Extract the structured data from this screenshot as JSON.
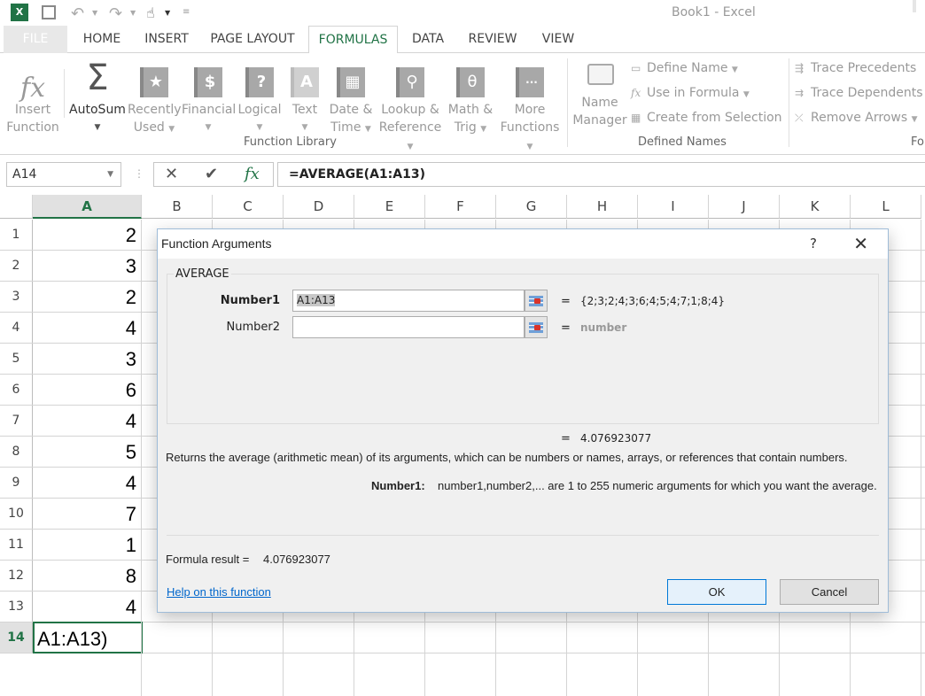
{
  "app": {
    "title": "Book1 - Excel",
    "quick_access": {
      "logo": "excel-logo-icon",
      "save": "save-icon",
      "undo": "undo-icon",
      "redo": "redo-icon",
      "touch": "touch-mode-icon",
      "customize": "customize-qat-icon"
    }
  },
  "tabs": [
    {
      "label": "FILE"
    },
    {
      "label": "HOME"
    },
    {
      "label": "INSERT"
    },
    {
      "label": "PAGE LAYOUT"
    },
    {
      "label": "FORMULAS",
      "active": true
    },
    {
      "label": "DATA"
    },
    {
      "label": "REVIEW"
    },
    {
      "label": "VIEW"
    }
  ],
  "ribbon": {
    "function_library": {
      "label": "Function Library",
      "insert_function": {
        "line1": "Insert",
        "line2": "Function",
        "icon": "fx"
      },
      "autosum": {
        "line1": "AutoSum",
        "icon": "Σ"
      },
      "recently_used": {
        "line1": "Recently",
        "line2": "Used",
        "icon": "★"
      },
      "financial": {
        "line1": "Financial",
        "icon": "$"
      },
      "logical": {
        "line1": "Logical",
        "icon": "?"
      },
      "text": {
        "line1": "Text",
        "icon": "A"
      },
      "date_time": {
        "line1": "Date &",
        "line2": "Time",
        "icon": "▦"
      },
      "lookup": {
        "line1": "Lookup &",
        "line2": "Reference",
        "icon": "⚲"
      },
      "math": {
        "line1": "Math &",
        "line2": "Trig",
        "icon": "θ"
      },
      "more": {
        "line1": "More",
        "line2": "Functions",
        "icon": "···"
      }
    },
    "defined_names": {
      "label": "Defined Names",
      "name_manager": {
        "line1": "Name",
        "line2": "Manager"
      },
      "define_name": "Define Name",
      "use_in_formula": "Use in Formula",
      "create_from_selection": "Create from Selection"
    },
    "formula_auditing": {
      "label": "Fo",
      "trace_precedents": "Trace Precedents",
      "trace_dependents": "Trace Dependents",
      "remove_arrows": "Remove Arrows"
    }
  },
  "formula_bar": {
    "name_box": "A14",
    "cancel_icon": "✕",
    "enter_icon": "✔",
    "fx_icon": "fx",
    "formula": "=AVERAGE(A1:A13)"
  },
  "grid": {
    "columns": [
      "A",
      "B",
      "C",
      "D",
      "E",
      "F",
      "G",
      "H",
      "I",
      "J",
      "K",
      "L"
    ],
    "selected_column": "A",
    "rows": [
      "1",
      "2",
      "3",
      "4",
      "5",
      "6",
      "7",
      "8",
      "9",
      "10",
      "11",
      "12",
      "13",
      "14"
    ],
    "selected_row": "14",
    "column_a_values": [
      "2",
      "3",
      "2",
      "4",
      "3",
      "6",
      "4",
      "5",
      "4",
      "7",
      "1",
      "8",
      "4"
    ],
    "active_cell_text": "A1:A13)"
  },
  "dialog": {
    "title": "Function Arguments",
    "help": "?",
    "close": "✕",
    "function_name": "AVERAGE",
    "args": [
      {
        "label": "Number1",
        "value": "A1:A13",
        "result": "{2;3;2;4;3;6;4;5;4;7;1;8;4}"
      },
      {
        "label": "Number2",
        "value": "",
        "result": "number"
      }
    ],
    "eq": "=",
    "total_result": "4.076923077",
    "description": "Returns the average (arithmetic mean) of its arguments, which can be numbers or names, arrays, or references that contain numbers.",
    "arg_help_label": "Number1:",
    "arg_help_text": "number1,number2,... are 1 to 255 numeric arguments for which you want the average.",
    "formula_result_label": "Formula result =",
    "formula_result_value": "4.076923077",
    "help_link": "Help on this function",
    "ok": "OK",
    "cancel": "Cancel"
  }
}
